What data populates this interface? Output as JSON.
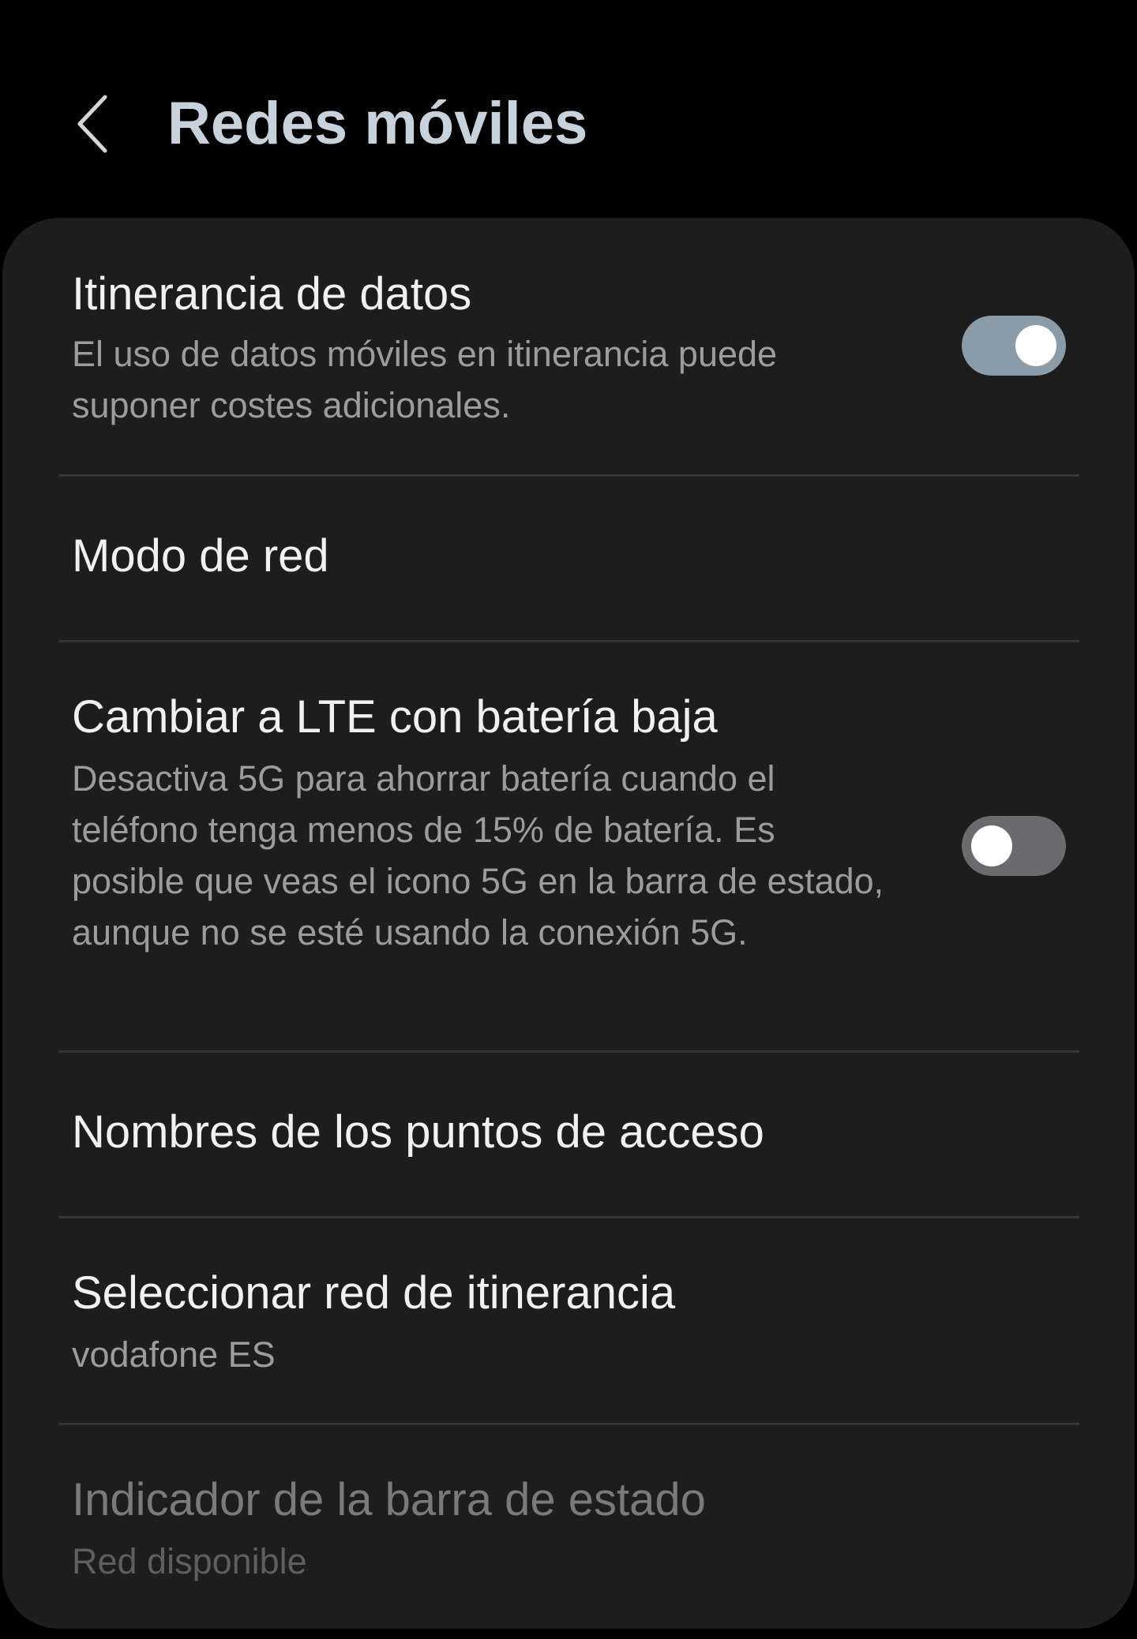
{
  "header": {
    "back_icon": "chevron-left-icon",
    "title": "Redes móviles",
    "title_color": "#c8d2dc"
  },
  "settings": {
    "data_roaming": {
      "title": "Itinerancia de datos",
      "subtitle": "El uso de datos móviles en itinerancia puede suponer costes adicionales.",
      "enabled": true,
      "toggle_color": "#8b9ca8"
    },
    "network_mode": {
      "title": "Modo de red"
    },
    "lte_low_battery": {
      "title": "Cambiar a LTE con batería baja",
      "subtitle": "Desactiva 5G para ahorrar batería cuando el teléfono tenga menos de 15% de batería. Es posible que veas el icono 5G en la barra de estado, aunque no se esté usando la conexión 5G.",
      "enabled": false
    },
    "apn": {
      "title": "Nombres de los puntos de acceso"
    },
    "roaming_network": {
      "title": "Seleccionar red de itinerancia",
      "subtitle": "vodafone ES"
    },
    "status_bar_indicator": {
      "title": "Indicador de la barra de estado",
      "subtitle": "Red disponible",
      "disabled": true
    }
  },
  "colors": {
    "background": "#000000",
    "card": "#1d1d1d",
    "primary_text": "#f1f1f1",
    "secondary_text": "#9c9c9c",
    "disabled_text": "#7a7a7a"
  }
}
